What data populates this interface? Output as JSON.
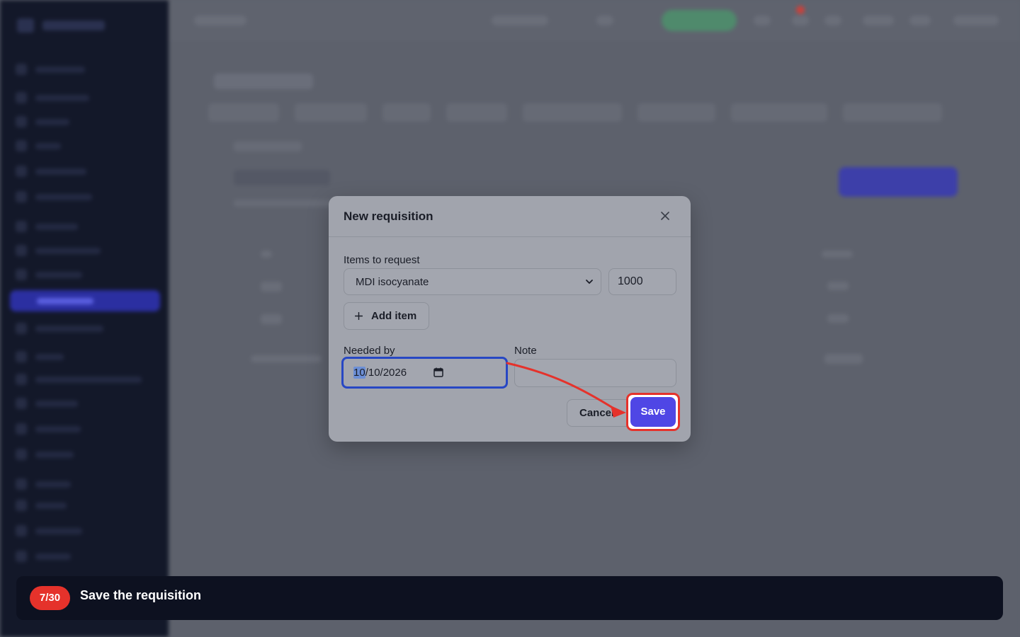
{
  "modal": {
    "title": "New requisition",
    "items_label": "Items to request",
    "item_selected": "MDI isocyanate",
    "quantity": "1000",
    "add_item_label": "Add item",
    "needed_by_label": "Needed by",
    "needed_by_month": "10",
    "needed_by_rest": "/10/2026",
    "note_label": "Note",
    "note_value": "",
    "cancel_label": "Cancel",
    "save_label": "Save"
  },
  "tutorial": {
    "step": "7/30",
    "instruction": "Save the requisition"
  },
  "colors": {
    "primary": "#4f46e5",
    "highlight": "#e5322b",
    "focus": "#2747c4",
    "banner": "#0d1120"
  },
  "icons": [
    "close-icon",
    "chevron-down-icon",
    "plus-icon",
    "calendar-icon",
    "pointer-arrow"
  ]
}
